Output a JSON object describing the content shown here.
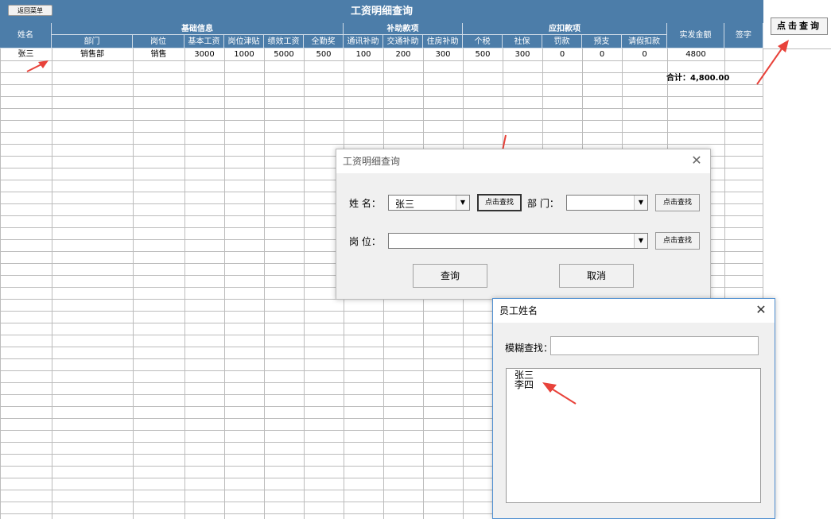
{
  "sheet": {
    "title": "工资明细查询",
    "back_button": "返回菜单",
    "query_button": "点击查询"
  },
  "headers": {
    "name": "姓名",
    "groups": {
      "basic": "基础信息",
      "subsidy": "补助款项",
      "deduction": "应扣款项",
      "net_pay": "实发金额",
      "signature": "签字"
    },
    "columns": [
      "部门",
      "岗位",
      "基本工资",
      "岗位津贴",
      "绩效工资",
      "全勤奖",
      "通讯补助",
      "交通补助",
      "住房补助",
      "个税",
      "社保",
      "罚款",
      "预支",
      "请假扣款"
    ]
  },
  "rows": [
    {
      "name": "张三",
      "cells": [
        "销售部",
        "销售",
        "3000",
        "1000",
        "5000",
        "500",
        "100",
        "200",
        "300",
        "500",
        "300",
        "0",
        "0",
        "0"
      ],
      "net_pay": "4800"
    }
  ],
  "total": "合计：4,800.00",
  "dialog_query": {
    "title": "工资明细查询",
    "name_label": "姓 名：",
    "name_value": "张三",
    "find_button": "点击查找",
    "dept_label": "部 门：",
    "dept_value": "",
    "post_label": "岗 位：",
    "post_value": "",
    "query_button": "查询",
    "cancel_button": "取消"
  },
  "dialog_employee": {
    "title": "员工姓名",
    "search_label": "模糊查找：",
    "search_value": "",
    "items": [
      "张三",
      "李四"
    ]
  },
  "colors": {
    "header_bg": "#4c7da9",
    "arrow": "#e8423a"
  }
}
